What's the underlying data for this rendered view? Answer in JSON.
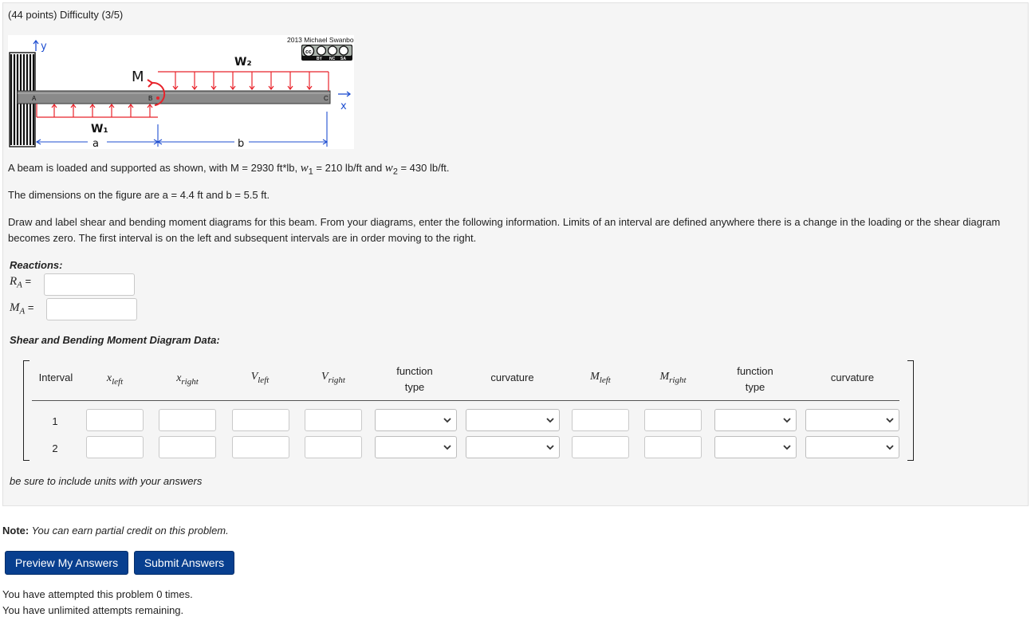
{
  "header": {
    "points_line": "(44 points) Difficulty (3/5)"
  },
  "figure": {
    "copyright": "2013 Michael Swanbom",
    "license_badge": "cc-by-nc-sa",
    "license_tags": [
      "BY",
      "NC",
      "SA"
    ],
    "labels": {
      "y_axis": "y",
      "x_axis": "x",
      "moment": "M",
      "w1": "W₁",
      "w2": "W₂",
      "point_a": "A",
      "point_b": "B",
      "point_c": "C",
      "dim_a": "a",
      "dim_b": "b"
    }
  },
  "problem": {
    "statement_pre": "A beam is loaded and supported as shown, with M = 2930 ft*lb, ",
    "w1_sym": "w",
    "w1_sub": "1",
    "w1_val": " = 210 lb/ft and ",
    "w2_sym": "w",
    "w2_sub": "2",
    "w2_val": " = 430 lb/ft.",
    "dimensions": "The dimensions on the figure are a = 4.4 ft and b = 5.5 ft.",
    "instructions": "Draw and label shear and bending moment diagrams for this beam. From your diagrams, enter the following information. Limits of an interval are defined anywhere there is a change in the loading or the shear diagram becomes zero. The first interval is on the left and subsequent intervals are in order moving to the right."
  },
  "reactions": {
    "heading": "Reactions:",
    "ra_sym": "R",
    "ra_sub": "A",
    "ra_eq": " =",
    "ra_value": "",
    "ma_sym": "M",
    "ma_sub": "A",
    "ma_eq": " =",
    "ma_value": ""
  },
  "table": {
    "heading": "Shear and Bending Moment Diagram Data:",
    "headers": {
      "interval": "Interval",
      "x_sym": "x",
      "left_sub": "left",
      "right_sub": "right",
      "v_sym": "V",
      "m_sym": "M",
      "function": "function",
      "type": "type",
      "curvature": "curvature"
    },
    "rows": [
      {
        "interval": "1",
        "x_left": "",
        "x_right": "",
        "v_left": "",
        "v_right": "",
        "v_function_type": "",
        "v_curvature": "",
        "m_left": "",
        "m_right": "",
        "m_function_type": "",
        "m_curvature": ""
      },
      {
        "interval": "2",
        "x_left": "",
        "x_right": "",
        "v_left": "",
        "v_right": "",
        "v_function_type": "",
        "v_curvature": "",
        "m_left": "",
        "m_right": "",
        "m_function_type": "",
        "m_curvature": ""
      }
    ],
    "units_note": "be sure to include units with your answers"
  },
  "footer": {
    "note_label": "Note:",
    "note_text": " You can earn partial credit on this problem.",
    "preview_button": "Preview My Answers",
    "submit_button": "Submit Answers",
    "attempts_line": "You have attempted this problem 0 times.",
    "remaining_line": "You have unlimited attempts remaining."
  },
  "colors": {
    "button_bg": "#083f8f",
    "load_red": "#e8232b",
    "dim_blue": "#1f4fd1"
  }
}
